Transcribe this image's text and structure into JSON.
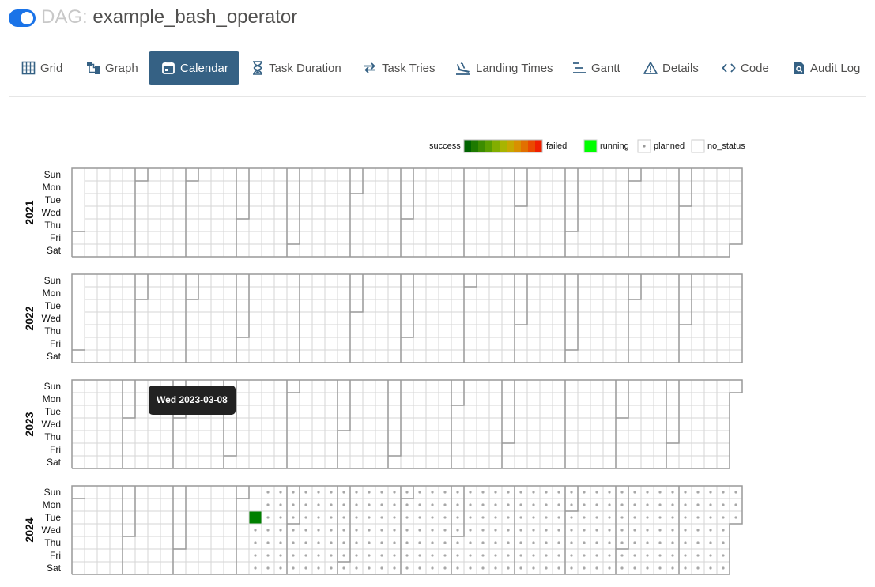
{
  "header": {
    "dag_prefix": "DAG:",
    "dag_name": "example_bash_operator",
    "toggle_on": true
  },
  "tabs": [
    {
      "label": "Grid",
      "icon": "grid-icon"
    },
    {
      "label": "Graph",
      "icon": "graph-icon"
    },
    {
      "label": "Calendar",
      "icon": "calendar-icon",
      "active": true
    },
    {
      "label": "Task Duration",
      "icon": "hourglass-icon"
    },
    {
      "label": "Task Tries",
      "icon": "retry-icon"
    },
    {
      "label": "Landing Times",
      "icon": "plane-landing-icon"
    },
    {
      "label": "Gantt",
      "icon": "gantt-icon"
    },
    {
      "label": "Details",
      "icon": "warning-triangle-icon"
    },
    {
      "label": "Code",
      "icon": "code-icon"
    },
    {
      "label": "Audit Log",
      "icon": "audit-log-icon"
    }
  ],
  "legend": {
    "success": "success",
    "failed": "failed",
    "running": "running",
    "planned": "planned",
    "no_status": "no_status",
    "gradient_colors": [
      "#006400",
      "#1e7a00",
      "#3c8c00",
      "#5a9e00",
      "#82ae00",
      "#a8b400",
      "#c6a800",
      "#d89000",
      "#e27000",
      "#ea4a00",
      "#f02000"
    ],
    "running_color": "#00ff00"
  },
  "calendar": {
    "day_labels": [
      "Sun",
      "Mon",
      "Tue",
      "Wed",
      "Thu",
      "Fri",
      "Sat"
    ],
    "years": [
      {
        "year": "2021"
      },
      {
        "year": "2022"
      },
      {
        "year": "2023"
      },
      {
        "year": "2024"
      }
    ],
    "runs": [
      {
        "date": "2024-04-09",
        "state": "success",
        "color": "#008000"
      }
    ],
    "planned_from": "2024-04-10"
  },
  "tooltip": {
    "text": "Wed 2023-03-08"
  }
}
